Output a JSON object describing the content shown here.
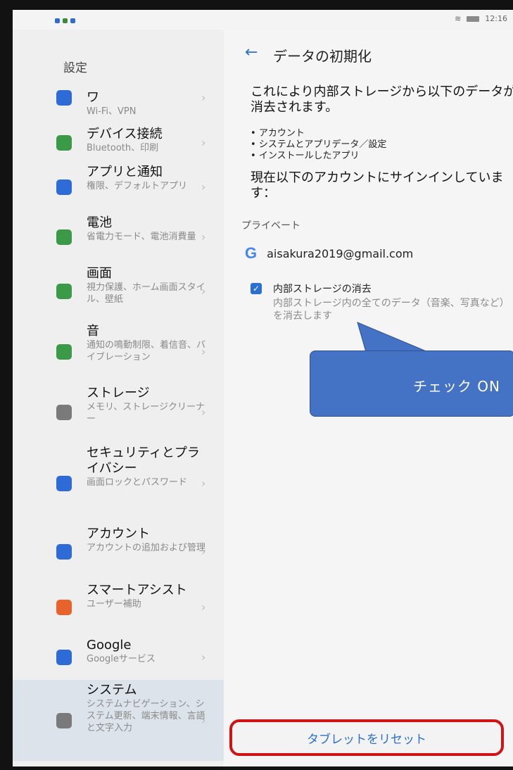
{
  "status": {
    "time": "12:16"
  },
  "sidebar": {
    "title": "設定",
    "items": [
      {
        "title": "ワ",
        "sub": "Wi-Fi、VPN",
        "icon": "network-icon",
        "color": "#2f6bd6"
      },
      {
        "title": "デバイス接続",
        "sub": "Bluetooth、印刷",
        "icon": "device-connection-icon",
        "color": "#3a9a47"
      },
      {
        "title": "アプリと通知",
        "sub": "権限、デフォルトアプリ",
        "icon": "apps-icon",
        "color": "#2f6bd6"
      },
      {
        "title": "電池",
        "sub": "省電力モード、電池消費量",
        "icon": "battery-icon",
        "color": "#3a9a47"
      },
      {
        "title": "画面",
        "sub": "視力保護、ホーム画面スタイル、壁紙",
        "icon": "display-icon",
        "color": "#3a9a47"
      },
      {
        "title": "音",
        "sub": "通知の鳴動制限、着信音、バイブレーション",
        "icon": "sound-icon",
        "color": "#3a9a47"
      },
      {
        "title": "ストレージ",
        "sub": "メモリ、ストレージクリーナー",
        "icon": "storage-icon",
        "color": "#7a7a7a"
      },
      {
        "title": "セキュリティとプライバシー",
        "sub": "画面ロックとパスワード",
        "icon": "security-icon",
        "color": "#2f6bd6"
      },
      {
        "title": "アカウント",
        "sub": "アカウントの追加および管理",
        "icon": "account-icon",
        "color": "#2f6bd6"
      },
      {
        "title": "スマートアシスト",
        "sub": "ユーザー補助",
        "icon": "smart-assist-icon",
        "color": "#e8622c"
      },
      {
        "title": "Google",
        "sub": "Googleサービス",
        "icon": "google-icon",
        "color": "#2f6bd6"
      },
      {
        "title": "システム",
        "sub": "システムナビゲーション、システム更新、端末情報、言語と文字入力",
        "icon": "system-icon",
        "color": "#7a7a7a"
      }
    ]
  },
  "main": {
    "back_label": "←",
    "title": "データの初期化",
    "intro": "これにより内部ストレージから以下のデータが消去されます。",
    "bullets": [
      "アカウント",
      "システムとアプリデータ／設定",
      "インストールしたアプリ"
    ],
    "signed_in": "現在以下のアカウントにサインインしています：",
    "section_label": "プライベート",
    "account_email": "aisakura2019@gmail.com",
    "google_letter": "G",
    "erase_title": "内部ストレージの消去",
    "erase_desc": "内部ストレージ内の全てのデータ（音楽、写真など）を消去します",
    "erase_checked": true,
    "reset_label": "タブレットをリセット"
  },
  "annotation": {
    "callout": "チェック ON"
  }
}
